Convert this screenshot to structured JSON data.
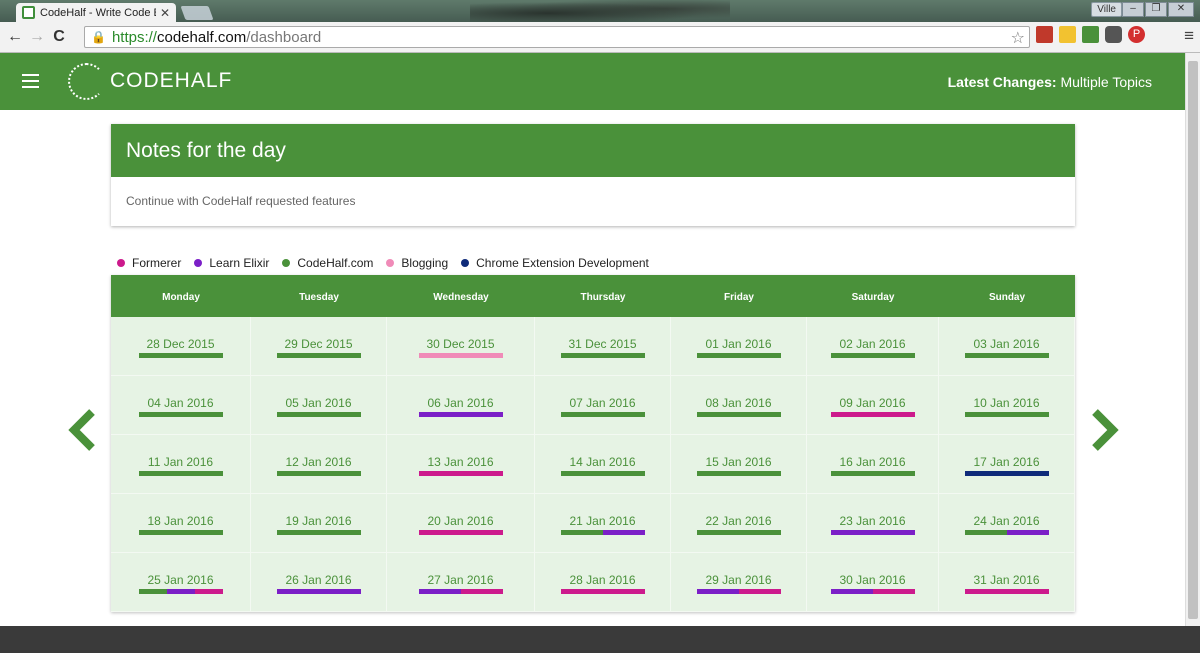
{
  "browser": {
    "tab_title": "CodeHalf - Write Code Ev",
    "tab_close": "✕",
    "user_name": "Ville",
    "url_scheme": "https://",
    "url_host": "codehalf.com",
    "url_path": "/dashboard",
    "back_icon": "←",
    "forward_icon": "→",
    "reload_icon": "C",
    "star_icon": "☆",
    "menu_icon": "≡"
  },
  "header": {
    "logo_text": "CODEHALF",
    "latest_label": "Latest Changes:",
    "latest_value": "Multiple Topics",
    "brand_color": "#4a913a"
  },
  "notes": {
    "title": "Notes for the day",
    "body": "Continue with CodeHalf requested features"
  },
  "legend": [
    {
      "label": "Formerer",
      "color": "#cc1a8c"
    },
    {
      "label": "Learn Elixir",
      "color": "#7b1fc7"
    },
    {
      "label": "CodeHalf.com",
      "color": "#4a913a"
    },
    {
      "label": "Blogging",
      "color": "#f08bb8"
    },
    {
      "label": "Chrome Extension Development",
      "color": "#0f2b7a"
    }
  ],
  "calendar": {
    "weekdays": [
      "Monday",
      "Tuesday",
      "Wednesday",
      "Thursday",
      "Friday",
      "Saturday",
      "Sunday"
    ],
    "weeks": [
      [
        {
          "date": "28 Dec 2015",
          "topics": [
            "CodeHalf.com"
          ]
        },
        {
          "date": "29 Dec 2015",
          "topics": [
            "CodeHalf.com"
          ]
        },
        {
          "date": "30 Dec 2015",
          "topics": [
            "Blogging"
          ]
        },
        {
          "date": "31 Dec 2015",
          "topics": [
            "CodeHalf.com"
          ]
        },
        {
          "date": "01 Jan 2016",
          "topics": [
            "CodeHalf.com"
          ]
        },
        {
          "date": "02 Jan 2016",
          "topics": [
            "CodeHalf.com"
          ]
        },
        {
          "date": "03 Jan 2016",
          "topics": [
            "CodeHalf.com"
          ]
        }
      ],
      [
        {
          "date": "04 Jan 2016",
          "topics": [
            "CodeHalf.com"
          ]
        },
        {
          "date": "05 Jan 2016",
          "topics": [
            "CodeHalf.com"
          ]
        },
        {
          "date": "06 Jan 2016",
          "topics": [
            "Learn Elixir"
          ]
        },
        {
          "date": "07 Jan 2016",
          "topics": [
            "CodeHalf.com"
          ]
        },
        {
          "date": "08 Jan 2016",
          "topics": [
            "CodeHalf.com"
          ]
        },
        {
          "date": "09 Jan 2016",
          "topics": [
            "Formerer"
          ]
        },
        {
          "date": "10 Jan 2016",
          "topics": [
            "CodeHalf.com"
          ]
        }
      ],
      [
        {
          "date": "11 Jan 2016",
          "topics": [
            "CodeHalf.com"
          ]
        },
        {
          "date": "12 Jan 2016",
          "topics": [
            "CodeHalf.com"
          ]
        },
        {
          "date": "13 Jan 2016",
          "topics": [
            "Formerer"
          ]
        },
        {
          "date": "14 Jan 2016",
          "topics": [
            "CodeHalf.com"
          ]
        },
        {
          "date": "15 Jan 2016",
          "topics": [
            "CodeHalf.com"
          ]
        },
        {
          "date": "16 Jan 2016",
          "topics": [
            "CodeHalf.com"
          ]
        },
        {
          "date": "17 Jan 2016",
          "topics": [
            "Chrome Extension Development"
          ]
        }
      ],
      [
        {
          "date": "18 Jan 2016",
          "topics": [
            "CodeHalf.com"
          ]
        },
        {
          "date": "19 Jan 2016",
          "topics": [
            "CodeHalf.com"
          ]
        },
        {
          "date": "20 Jan 2016",
          "topics": [
            "Formerer"
          ]
        },
        {
          "date": "21 Jan 2016",
          "topics": [
            "CodeHalf.com",
            "Learn Elixir"
          ]
        },
        {
          "date": "22 Jan 2016",
          "topics": [
            "CodeHalf.com"
          ]
        },
        {
          "date": "23 Jan 2016",
          "topics": [
            "Learn Elixir"
          ]
        },
        {
          "date": "24 Jan 2016",
          "topics": [
            "CodeHalf.com",
            "Learn Elixir"
          ]
        }
      ],
      [
        {
          "date": "25 Jan 2016",
          "topics": [
            "CodeHalf.com",
            "Learn Elixir",
            "Formerer"
          ]
        },
        {
          "date": "26 Jan 2016",
          "topics": [
            "Learn Elixir"
          ]
        },
        {
          "date": "27 Jan 2016",
          "topics": [
            "Learn Elixir",
            "Formerer"
          ]
        },
        {
          "date": "28 Jan 2016",
          "topics": [
            "Formerer"
          ]
        },
        {
          "date": "29 Jan 2016",
          "topics": [
            "Learn Elixir",
            "Formerer"
          ]
        },
        {
          "date": "30 Jan 2016",
          "topics": [
            "Learn Elixir",
            "Formerer"
          ]
        },
        {
          "date": "31 Jan 2016",
          "topics": [
            "Formerer"
          ]
        }
      ]
    ],
    "prev_icon": "chevron-left-icon",
    "next_icon": "chevron-right-icon"
  }
}
